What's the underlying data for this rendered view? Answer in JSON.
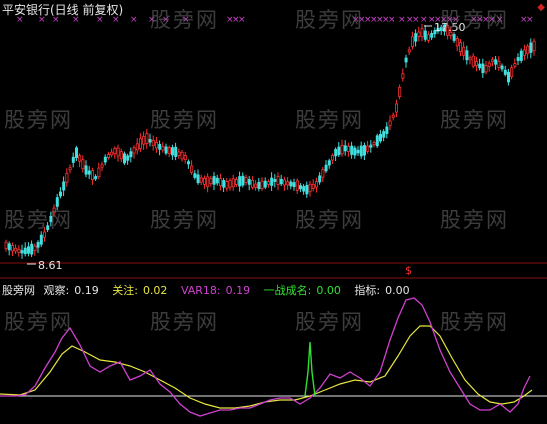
{
  "header": {
    "title": "平安银行(日线 前复权)"
  },
  "price_labels": {
    "high": "17.50",
    "low": "8.61"
  },
  "indicator": {
    "name": "股旁网",
    "items": [
      {
        "label": "观察:",
        "value": "0.19",
        "color": "#e6e6e6"
      },
      {
        "label": "关注:",
        "value": "0.02",
        "color": "#e6e640"
      },
      {
        "label": "VAR18:",
        "value": "0.19",
        "color": "#d040d0"
      },
      {
        "label": "一战成名:",
        "value": "0.00",
        "color": "#30e030"
      },
      {
        "label": "指标:",
        "value": "0.00",
        "color": "#e6e6e6"
      }
    ]
  },
  "watermark": "股旁网",
  "marker": "$",
  "colors": {
    "up": "#ff3030",
    "down": "#40e0e0",
    "magenta": "#d040d0",
    "yellow": "#e6e640",
    "green": "#30e030",
    "white": "#e6e6e6",
    "grid": "#8a1010"
  }
}
